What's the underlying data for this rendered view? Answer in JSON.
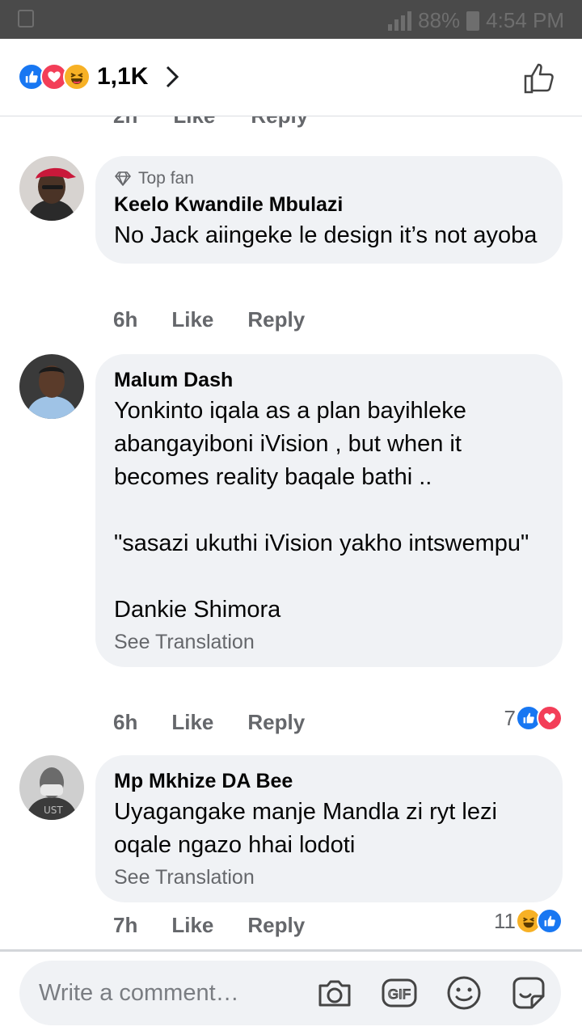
{
  "status_bar": {
    "battery": "88%",
    "time": "4:54 PM"
  },
  "header": {
    "reaction_count": "1,1K",
    "reaction_icons": [
      "like-icon",
      "love-icon",
      "haha-icon"
    ]
  },
  "previous_comment": {
    "time": "2h",
    "like": "Like",
    "reply": "Reply"
  },
  "comments": [
    {
      "badge": "Top fan",
      "author": "Keelo Kwandile Mbulazi",
      "text": "No Jack aiingeke le design it’s not ayoba",
      "time": "6h",
      "like": "Like",
      "reply": "Reply"
    },
    {
      "author": "Malum Dash",
      "text": "Yonkinto iqala as a plan bayihleke abangayiboni iVision , but when it becomes reality baqale bathi ..\n\n\"sasazi ukuthi iVision yakho intswempu\"\n\nDankie Shimora",
      "see_translation": "See Translation",
      "time": "6h",
      "like": "Like",
      "reply": "Reply",
      "reaction_count": "7",
      "reaction_icons": [
        "like-icon",
        "love-icon"
      ]
    },
    {
      "author": "Mp Mkhize DA Bee",
      "text": "Uyagangake manje Mandla zi ryt lezi oqale ngazo hhai lodoti",
      "see_translation": "See Translation",
      "time": "7h",
      "like": "Like",
      "reply": "Reply",
      "reaction_count": "11",
      "reaction_icons": [
        "haha-icon",
        "like-icon"
      ]
    }
  ],
  "composer": {
    "placeholder": "Write a comment…",
    "icons": [
      "camera-icon",
      "gif-icon",
      "emoji-icon",
      "sticker-icon"
    ]
  },
  "colors": {
    "accent": "#1877f2",
    "love": "#f33e58",
    "haha": "#f7b125",
    "bubble": "#f0f2f5",
    "secondary_text": "#65676b"
  }
}
